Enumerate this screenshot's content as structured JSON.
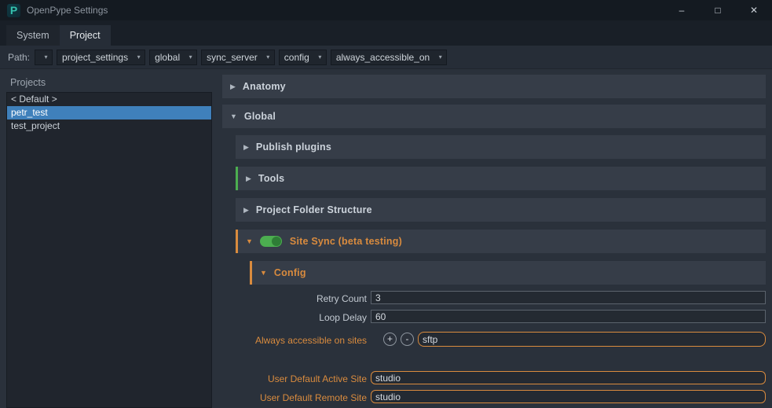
{
  "window": {
    "title": "OpenPype Settings"
  },
  "icons": {
    "logo_letter": "P",
    "minimize": "–",
    "maximize": "□",
    "close": "✕",
    "dropdown_arrow": "▾",
    "collapsed_arrow": "▶",
    "expanded_arrow": "▼",
    "add": "+",
    "remove": "-"
  },
  "tabs": {
    "system": "System",
    "project": "Project"
  },
  "path": {
    "label": "Path:",
    "segments": [
      "",
      "project_settings",
      "global",
      "sync_server",
      "config",
      "always_accessible_on"
    ]
  },
  "projects_panel": {
    "title": "Projects",
    "items": [
      "< Default >",
      "petr_test",
      "test_project"
    ],
    "selected": "petr_test"
  },
  "sections": {
    "anatomy": "Anatomy",
    "global": "Global",
    "publish_plugins": "Publish plugins",
    "tools": "Tools",
    "project_folder_structure": "Project Folder Structure",
    "site_sync": "Site Sync (beta testing)",
    "config": "Config"
  },
  "fields": {
    "retry_count": {
      "label": "Retry Count",
      "value": "3"
    },
    "loop_delay": {
      "label": "Loop Delay",
      "value": "60"
    },
    "always_accessible_on_sites": {
      "label": "Always accessible on sites",
      "value": "sftp"
    },
    "user_default_active_site": {
      "label": "User Default Active Site",
      "value": "studio"
    },
    "user_default_remote_site": {
      "label": "User Default Remote Site",
      "value": "studio"
    }
  },
  "colors": {
    "accent_orange": "#d98b3e",
    "toggle_on_green": "#4cae50",
    "selection_blue": "#3f80bb",
    "tools_edge_green": "#4cae50"
  }
}
